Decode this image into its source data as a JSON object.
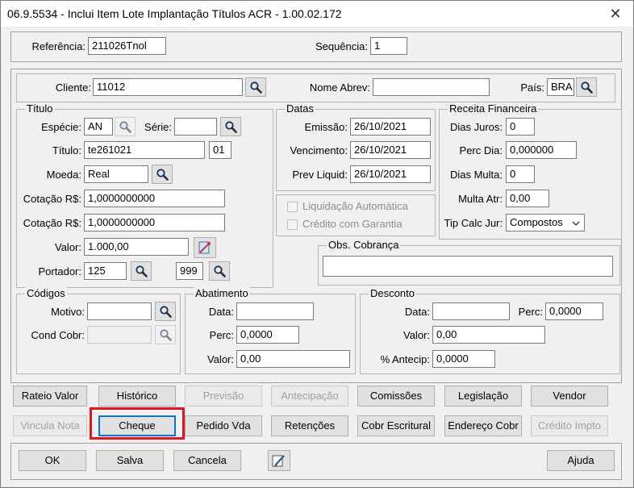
{
  "window": {
    "title": "06.9.5534 - Inclui Item Lote Implantação Títulos ACR - 1.00.02.172",
    "close_glyph": "✕"
  },
  "top": {
    "referencia_label": "Referência:",
    "referencia_value": "211026Tnol",
    "sequencia_label": "Sequência:",
    "sequencia_value": "1"
  },
  "cliente": {
    "label": "Cliente:",
    "value": "11012",
    "nome_abrev_label": "Nome Abrev:",
    "nome_abrev_value": "",
    "pais_label": "País:",
    "pais_value": "BRA"
  },
  "titulo_group": {
    "title": "Título",
    "especie_label": "Espécie:",
    "especie_value": "AN",
    "serie_label": "Série:",
    "serie_value": "",
    "titulo_label": "Título:",
    "titulo_value": "te261021",
    "parcela_value": "01",
    "moeda_label": "Moeda:",
    "moeda_value": "Real",
    "cotacao1_label": "Cotação R$:",
    "cotacao1_value": "1,0000000000",
    "cotacao2_label": "Cotação R$:",
    "cotacao2_value": "1,0000000000",
    "valor_label": "Valor:",
    "valor_value": "1.000,00",
    "portador_label": "Portador:",
    "portador_value": "125",
    "carteira_value": "999"
  },
  "datas_group": {
    "title": "Datas",
    "emissao_label": "Emissão:",
    "emissao_value": "26/10/2021",
    "vencimento_label": "Vencimento:",
    "vencimento_value": "26/10/2021",
    "prev_liquid_label": "Prev Liquid:",
    "prev_liquid_value": "26/10/2021",
    "liquidacao_automatica_label": "Liquidação Automática",
    "credito_garantia_label": "Crédito com Garantia"
  },
  "receita_group": {
    "title": "Receita Financeira",
    "dias_juros_label": "Dias Juros:",
    "dias_juros_value": "0",
    "perc_dia_label": "Perc Dia:",
    "perc_dia_value": "0,000000",
    "dias_multa_label": "Dias Multa:",
    "dias_multa_value": "0",
    "multa_atr_label": "Multa Atr:",
    "multa_atr_value": "0,00",
    "tip_calc_label": "Tip Calc Jur:",
    "tip_calc_value": "Compostos"
  },
  "obs_group": {
    "title": "Obs. Cobrança",
    "value": ""
  },
  "codigos_group": {
    "title": "Códigos",
    "motivo_label": "Motivo:",
    "motivo_value": "",
    "cond_cobr_label": "Cond Cobr:",
    "cond_cobr_value": ""
  },
  "abatimento_group": {
    "title": "Abatimento",
    "data_label": "Data:",
    "data_value": "",
    "perc_label": "Perc:",
    "perc_value": "0,0000",
    "valor_label": "Valor:",
    "valor_value": "0,00"
  },
  "desconto_group": {
    "title": "Desconto",
    "data_label": "Data:",
    "data_value": "",
    "perc_label": "Perc:",
    "perc_value": "0,0000",
    "valor_label": "Valor:",
    "valor_value": "0,00",
    "antecip_label": "% Antecip:",
    "antecip_value": "0,0000"
  },
  "buttons_row1": {
    "rateio_valor": "Rateio Valor",
    "historico": "Histórico",
    "previsao": "Previsão",
    "antecipacao": "Antecipação",
    "comissoes": "Comissões",
    "legislacao": "Legislação",
    "vendor": "Vendor"
  },
  "buttons_row2": {
    "vincula_nota": "Vincula Nota",
    "cheque": "Cheque",
    "pedido_vda": "Pedido Vda",
    "retencoes": "Retenções",
    "cobr_escritural": "Cobr Escritural",
    "endereco_cobr": "Endereço Cobr",
    "credito_impto": "Crédito Impto"
  },
  "bottom_buttons": {
    "ok": "OK",
    "salva": "Salva",
    "cancela": "Cancela",
    "ajuda": "Ajuda"
  },
  "colors": {
    "highlight": "#e5141b",
    "focus": "#0078d7",
    "client_bg": "#f0f0f0"
  }
}
